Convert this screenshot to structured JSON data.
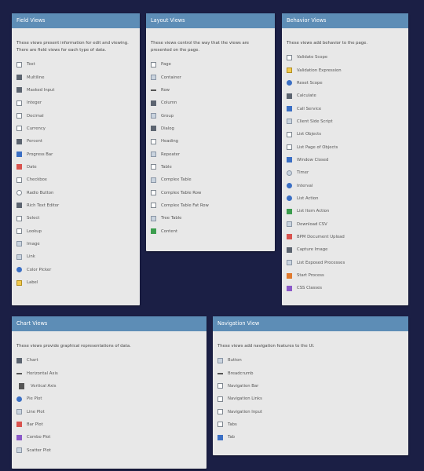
{
  "field_views": {
    "title": "Field Views",
    "description": "These views present information for edit and viewing. There are field views for each type of data.",
    "items": [
      {
        "label": "Text",
        "icon": "text-icon"
      },
      {
        "label": "Multiline",
        "icon": "multiline-icon"
      },
      {
        "label": "Masked Input",
        "icon": "masked-input-icon"
      },
      {
        "label": "Integer",
        "icon": "integer-icon"
      },
      {
        "label": "Decimal",
        "icon": "decimal-icon"
      },
      {
        "label": "Currency",
        "icon": "currency-icon"
      },
      {
        "label": "Percent",
        "icon": "percent-icon"
      },
      {
        "label": "Progress Bar",
        "icon": "progress-bar-icon"
      },
      {
        "label": "Date",
        "icon": "calendar-icon"
      },
      {
        "label": "Checkbox",
        "icon": "checkbox-icon"
      },
      {
        "label": "Radio Button",
        "icon": "radio-button-icon"
      },
      {
        "label": "Rich Text Editor",
        "icon": "rich-text-icon"
      },
      {
        "label": "Select",
        "icon": "select-icon"
      },
      {
        "label": "Lookup",
        "icon": "lookup-icon"
      },
      {
        "label": "Image",
        "icon": "image-icon"
      },
      {
        "label": "Link",
        "icon": "link-icon"
      },
      {
        "label": "Color Picker",
        "icon": "color-picker-icon"
      },
      {
        "label": "Label",
        "icon": "label-icon"
      }
    ]
  },
  "layout_views": {
    "title": "Layout Views",
    "description": "These views control the way that the views are presented on the page.",
    "items": [
      {
        "label": "Page",
        "icon": "page-icon"
      },
      {
        "label": "Container",
        "icon": "container-icon"
      },
      {
        "label": "Row",
        "icon": "row-icon"
      },
      {
        "label": "Column",
        "icon": "column-icon"
      },
      {
        "label": "Group",
        "icon": "group-icon"
      },
      {
        "label": "Dialog",
        "icon": "dialog-icon"
      },
      {
        "label": "Heading",
        "icon": "heading-icon"
      },
      {
        "label": "Repeater",
        "icon": "repeater-icon"
      },
      {
        "label": "Table",
        "icon": "table-icon"
      },
      {
        "label": "Complex Table",
        "icon": "complex-table-icon"
      },
      {
        "label": "Complex Table Row",
        "icon": "complex-table-row-icon"
      },
      {
        "label": "Complex Table Fat Row",
        "icon": "complex-table-fat-row-icon"
      },
      {
        "label": "Tree Table",
        "icon": "tree-table-icon"
      },
      {
        "label": "Content",
        "icon": "content-icon"
      }
    ]
  },
  "behavior_views": {
    "title": "Behavior Views",
    "description": "These views add behavior to the page.",
    "items": [
      {
        "label": "Validate Scope",
        "icon": "validate-scope-icon"
      },
      {
        "label": "Validation Expression",
        "icon": "validation-expression-icon"
      },
      {
        "label": "Reset Scope",
        "icon": "reset-scope-icon"
      },
      {
        "label": "Calculate",
        "icon": "calculate-icon"
      },
      {
        "label": "Call Service",
        "icon": "call-service-icon"
      },
      {
        "label": "Client Side Script",
        "icon": "client-script-icon"
      },
      {
        "label": "List Objects",
        "icon": "list-objects-icon"
      },
      {
        "label": "List Page of Objects",
        "icon": "list-page-icon"
      },
      {
        "label": "Window Closed",
        "icon": "window-closed-icon"
      },
      {
        "label": "Timer",
        "icon": "timer-icon"
      },
      {
        "label": "Interval",
        "icon": "interval-icon"
      },
      {
        "label": "List Action",
        "icon": "list-action-icon"
      },
      {
        "label": "List Item Action",
        "icon": "list-item-action-icon"
      },
      {
        "label": "Download CSV",
        "icon": "download-csv-icon"
      },
      {
        "label": "BPM Document Upload",
        "icon": "document-upload-icon"
      },
      {
        "label": "Capture Image",
        "icon": "capture-image-icon"
      },
      {
        "label": "List Exposed Processes",
        "icon": "exposed-processes-icon"
      },
      {
        "label": "Start Process",
        "icon": "start-process-icon"
      },
      {
        "label": "CSS Classes",
        "icon": "css-classes-icon"
      }
    ]
  },
  "chart_views": {
    "title": "Chart Views",
    "description": "These views provide graphical representations of data.",
    "items": [
      {
        "label": "Chart",
        "icon": "chart-icon"
      },
      {
        "label": "Horizontal Axis",
        "icon": "horizontal-axis-icon"
      },
      {
        "label": "Vertical Axis",
        "icon": "vertical-axis-icon"
      },
      {
        "label": "Pie Plot",
        "icon": "pie-plot-icon"
      },
      {
        "label": "Line Plot",
        "icon": "line-plot-icon"
      },
      {
        "label": "Bar Plot",
        "icon": "bar-plot-icon"
      },
      {
        "label": "Combo Plot",
        "icon": "combo-plot-icon"
      },
      {
        "label": "Scatter Plot",
        "icon": "scatter-plot-icon"
      }
    ]
  },
  "navigation_view": {
    "title": "Navigation View",
    "description": "These views add navigation features to the UI.",
    "items": [
      {
        "label": "Button",
        "icon": "button-icon"
      },
      {
        "label": "Breadcrumb",
        "icon": "breadcrumb-icon"
      },
      {
        "label": "Navigation Bar",
        "icon": "navigation-bar-icon"
      },
      {
        "label": "Navigation Links",
        "icon": "navigation-links-icon"
      },
      {
        "label": "Navigation Input",
        "icon": "navigation-input-icon"
      },
      {
        "label": "Tabs",
        "icon": "tabs-icon"
      },
      {
        "label": "Tab",
        "icon": "tab-icon"
      }
    ]
  },
  "colors": {
    "background": "#1b1f45",
    "header": "#5d8db6",
    "card": "#e8e8e8"
  }
}
